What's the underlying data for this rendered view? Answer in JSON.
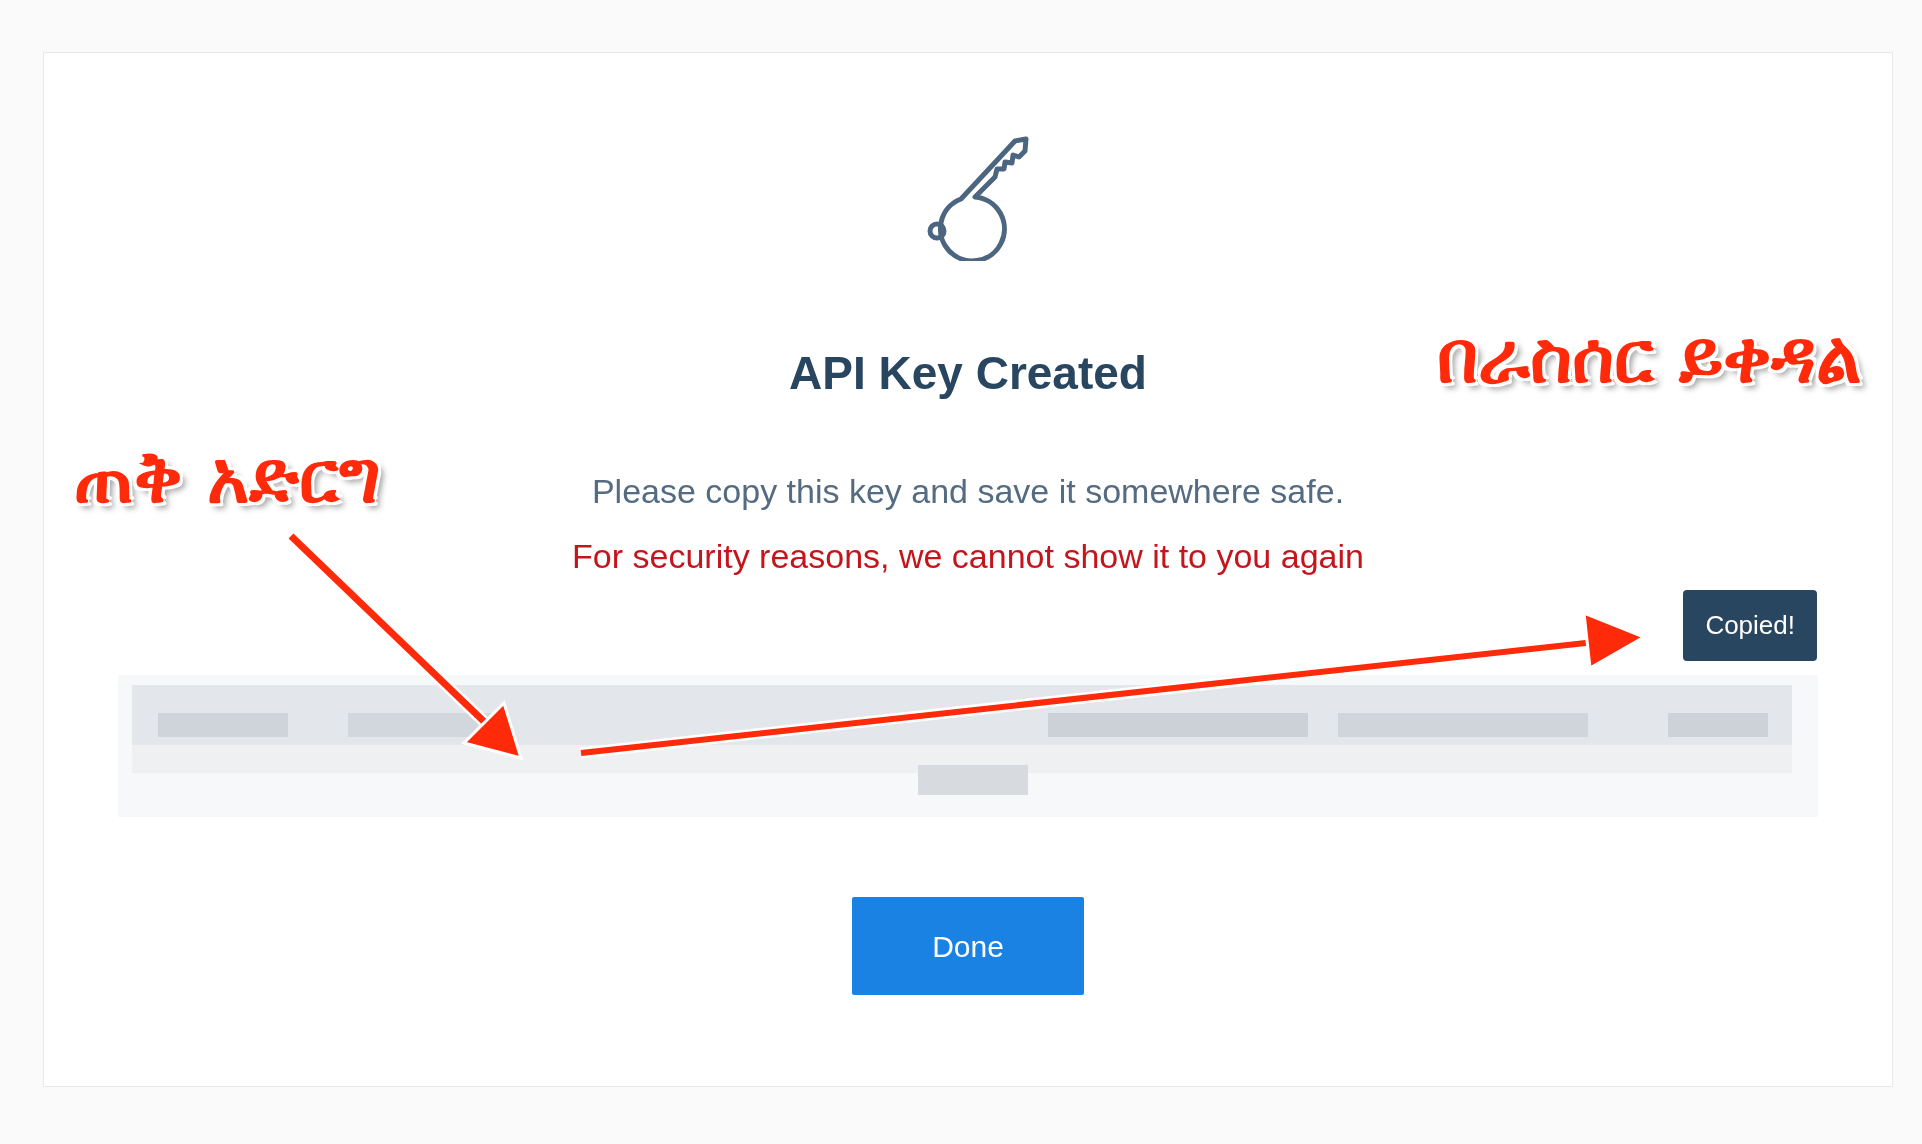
{
  "card": {
    "title": "API Key Created",
    "instructions": "Please copy this key and save it somewhere safe.",
    "warning": "For security reasons, we cannot show it to you again",
    "tooltip": "Copied!",
    "done_button": "Done"
  },
  "annotations": [
    {
      "text": "ጠቅ አድርግ"
    },
    {
      "text": "በራስሰር ይቀዳል"
    }
  ]
}
